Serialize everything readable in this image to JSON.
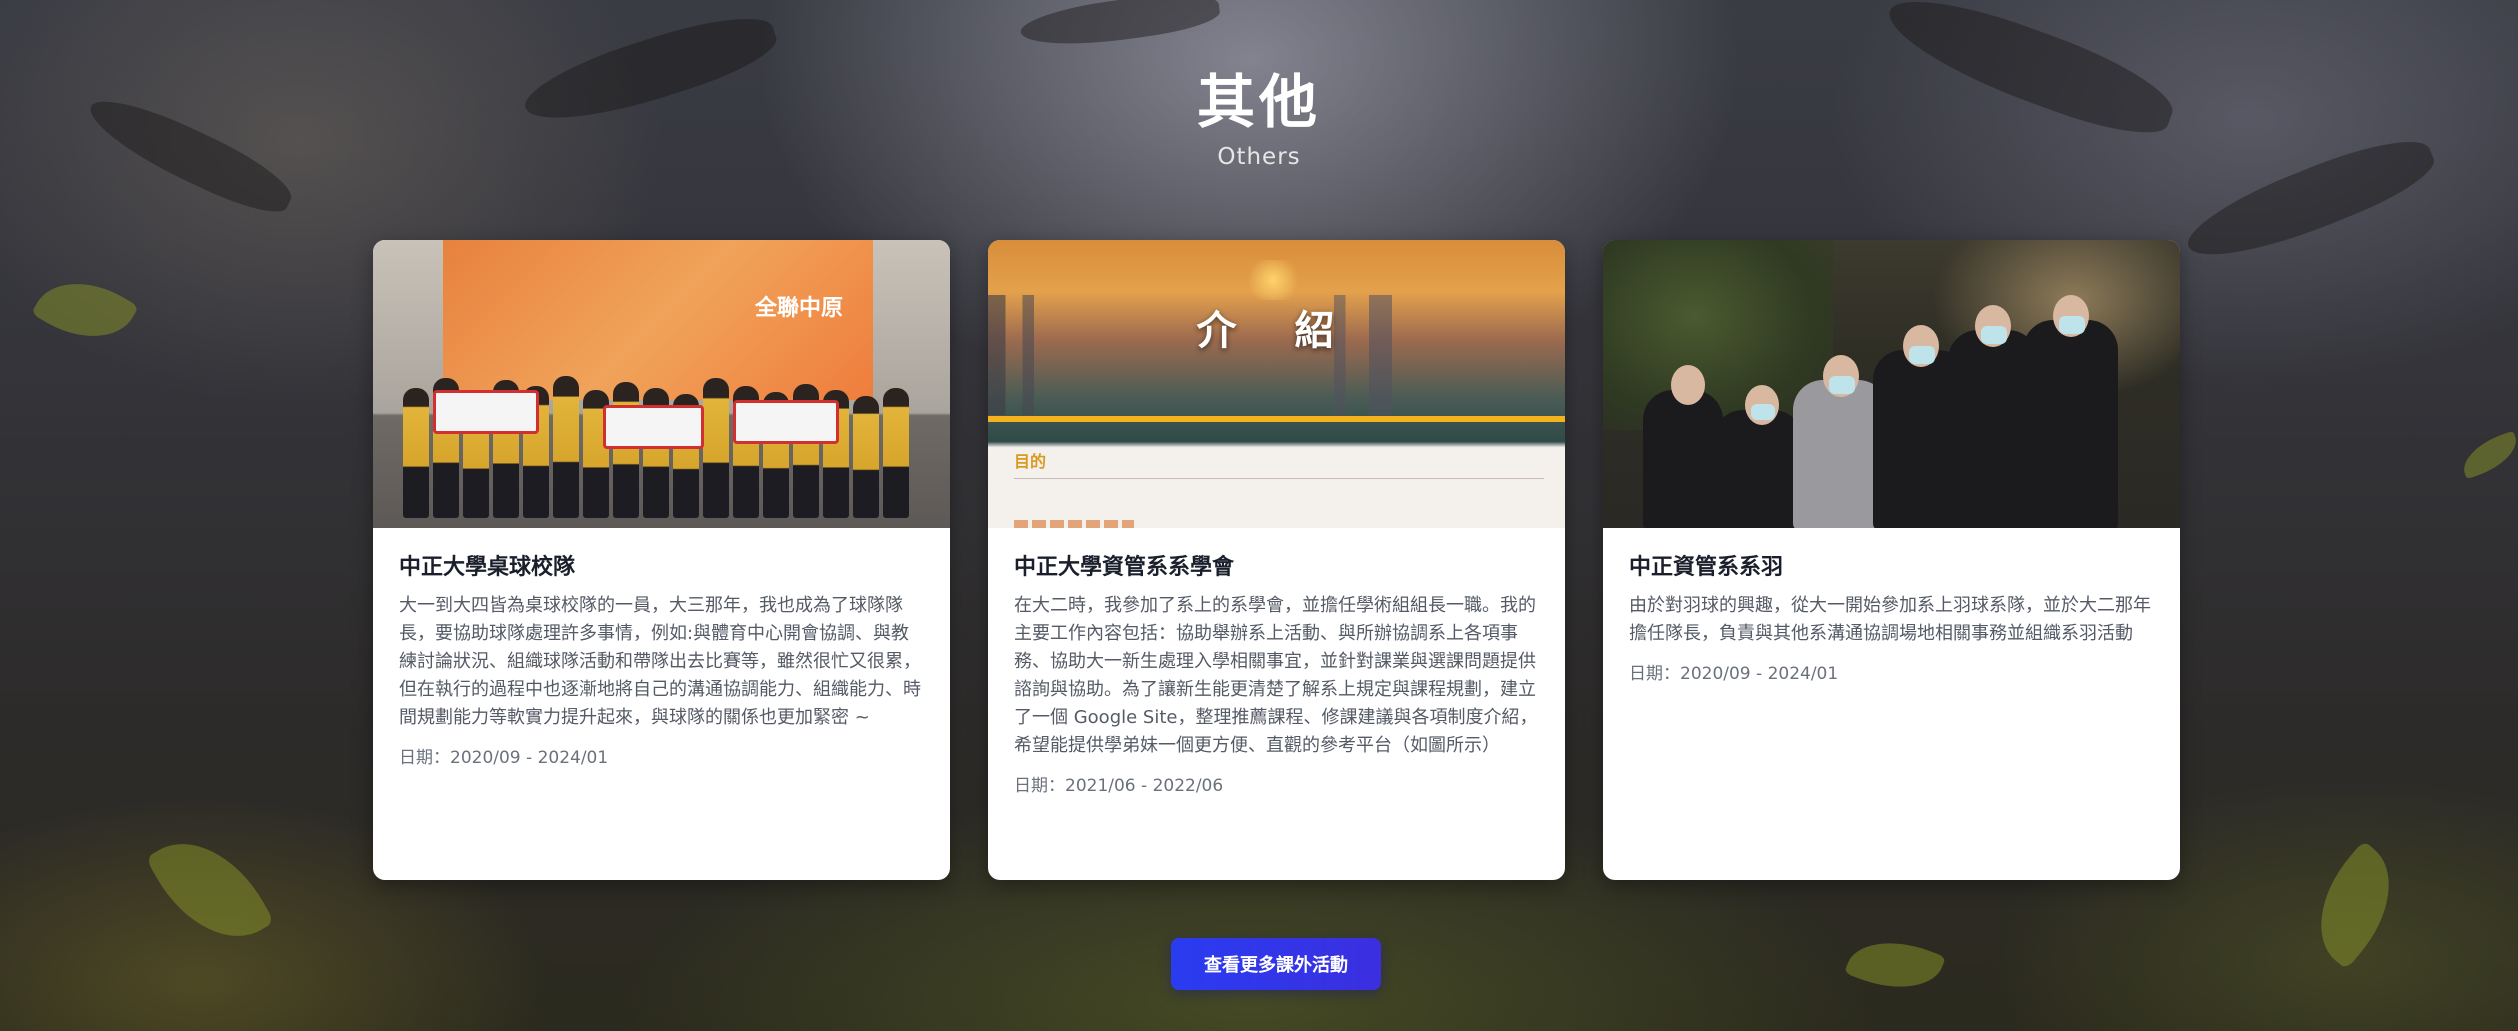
{
  "section": {
    "title": "其他",
    "subtitle": "Others"
  },
  "cards": [
    {
      "title": "中正大學桌球校隊",
      "description": "大一到大四皆為桌球校隊的一員，大三那年，我也成為了球隊隊長，要協助球隊處理許多事情，例如:與體育中心開會協調、與教練討論狀況、組織球隊活動和帶隊出去比賽等，雖然很忙又很累，但在執行的過程中也逐漸地將自己的溝通協調能力、組織能力、時間規劃能力等軟實力提升起來，與球隊的關係也更加緊密 ~",
      "date": "日期：2020/09 - 2024/01",
      "image": {
        "banner_text": "全聯中原"
      }
    },
    {
      "title": "中正大學資管系系學會",
      "description": "在大二時，我參加了系上的系學會，並擔任學術組組長一職。我的主要工作內容包括：協助舉辦系上活動、與所辦協調系上各項事務、協助大一新生處理入學相關事宜，並針對課業與選課問題提供諮詢與協助。為了讓新生能更清楚了解系上規定與課程規劃，建立了一個 Google Site，整理推薦課程、修課建議與各項制度介紹，希望能提供學弟妹一個更方便、直觀的參考平台（如圖所示）",
      "date": "日期：2021/06 - 2022/06",
      "image": {
        "heading": "介 紹",
        "section_label": "目的"
      }
    },
    {
      "title": "中正資管系系羽",
      "description": "由於對羽球的興趣，從大一開始參加系上羽球系隊，並於大二那年擔任隊長，負責與其他系溝通協調場地相關事務並組織系羽活動",
      "date": "日期：2020/09 - 2024/01",
      "image": {}
    }
  ],
  "more_button": {
    "label": "查看更多課外活動"
  },
  "colors": {
    "button_start": "#2a3cf0",
    "button_end": "#3b2fe0",
    "card_bg": "#ffffff",
    "title_text": "#ffffff"
  }
}
